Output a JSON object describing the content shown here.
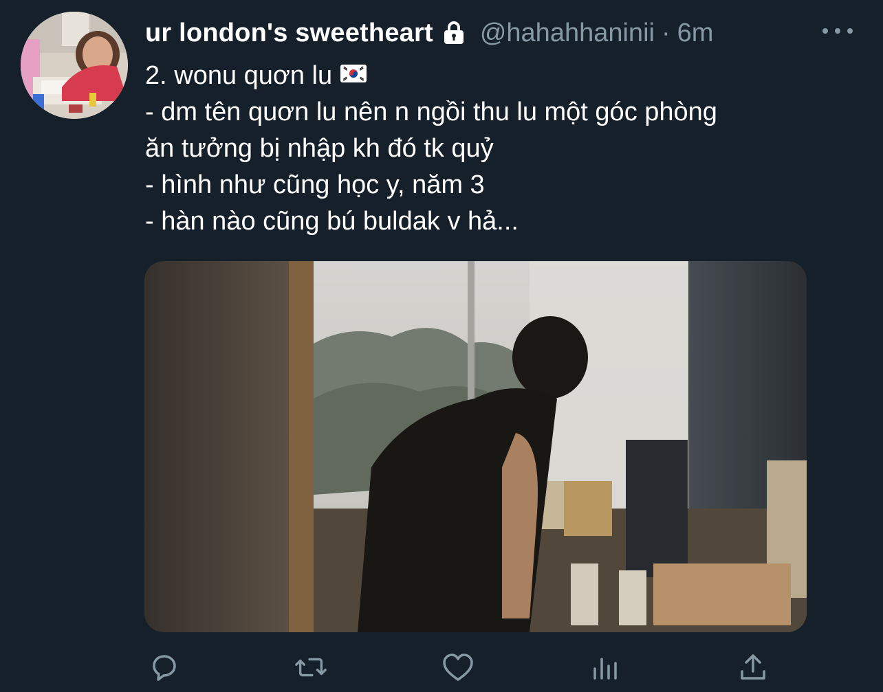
{
  "tweet": {
    "display_name": "ur london's sweetheart",
    "handle": "@hahahhaninii",
    "separator": "·",
    "timestamp": "6m",
    "text_lines": [
      "2. wonu quơn lu",
      "- dm tên quơn lu nên n ngồi thu lu một góc phòng",
      "ăn tưởng bị nhập kh đó tk quỷ",
      "- hình như cũng học y, năm 3",
      "- hàn nào cũng bú buldak v hả..."
    ],
    "flag_icon": "south-korea-flag-icon",
    "protected_icon": "lock-icon"
  },
  "actions": {
    "icons": [
      "reply-icon",
      "retweet-icon",
      "like-icon",
      "analytics-icon",
      "share-icon"
    ]
  },
  "colors": {
    "background": "#15202b",
    "primary_text": "#ffffff",
    "secondary_text": "#8899a6"
  }
}
